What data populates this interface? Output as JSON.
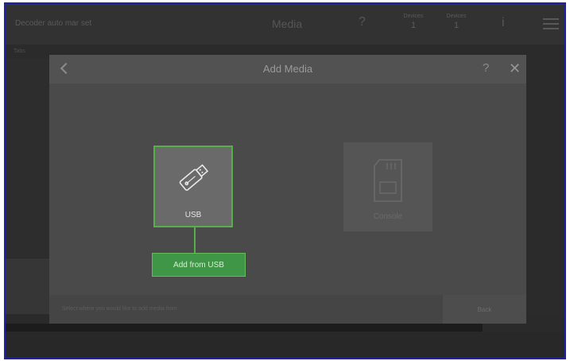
{
  "topbar": {
    "device_label": "Decoder auto mar set",
    "title": "Media",
    "help_icon": "?",
    "counter_a": {
      "label": "Devices",
      "value": "1"
    },
    "counter_b": {
      "label": "Devices",
      "value": "1"
    },
    "info_icon": "i",
    "menu_icon": "hamburger-menu-icon"
  },
  "subbar": {
    "tab": "Tabs"
  },
  "modal": {
    "title": "Add Media",
    "help": "?",
    "close": "✕",
    "usb_option": {
      "label": "USB",
      "icon": "usb-drive-icon"
    },
    "add_button": "Add from USB",
    "console_option": {
      "label": "Console",
      "icon": "sd-card-icon"
    },
    "footer_hint": "Select where you would like to add media from",
    "back_button": "Back"
  },
  "colors": {
    "accent": "#55b04a",
    "button": "#3f9646",
    "frame_border": "#1e22a3"
  }
}
